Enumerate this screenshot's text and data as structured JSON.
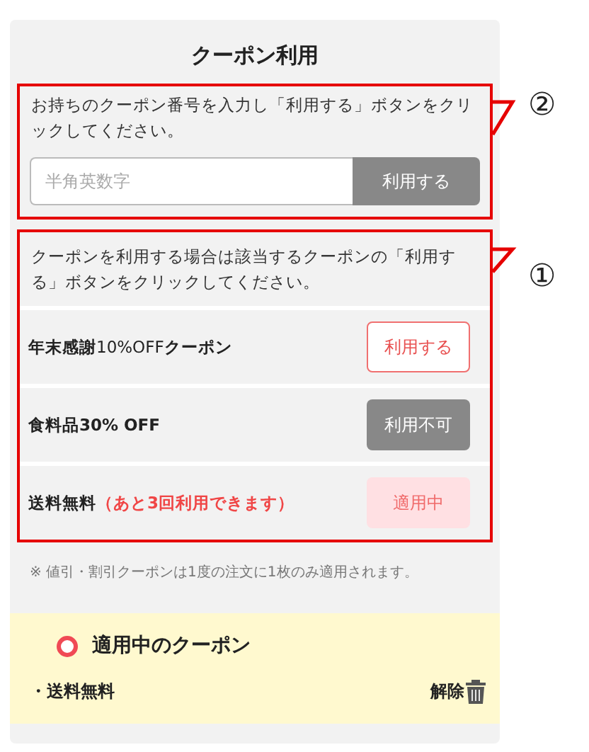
{
  "title": "クーポン利用",
  "code_entry": {
    "callout": "②",
    "instruction": "お持ちのクーポン番号を入力し「利用する」ボタンをクリックしてください。",
    "placeholder": "半角英数字",
    "button": "利用する"
  },
  "coupon_list": {
    "callout": "①",
    "instruction": "クーポンを利用する場合は該当するクーポンの「利用する」ボタンをクリックしてください。",
    "coupons": [
      {
        "name": "**年末感謝**10%OFF**クーポン**",
        "kind": "available",
        "button": "利用する"
      },
      {
        "name": "食料品30% OFF",
        "kind": "unavailable",
        "button": "利用不可"
      },
      {
        "name": "送料無料",
        "note": "（あと3回利用できます）",
        "kind": "applied",
        "button": "適用中"
      }
    ]
  },
  "footnote": "※ 値引・割引クーポンは1度の注文に1枚のみ適用されます。",
  "applied": {
    "heading": "適用中のクーポン",
    "items": [
      {
        "bullet": "・",
        "name": "送料無料",
        "remove": "解除"
      }
    ]
  }
}
